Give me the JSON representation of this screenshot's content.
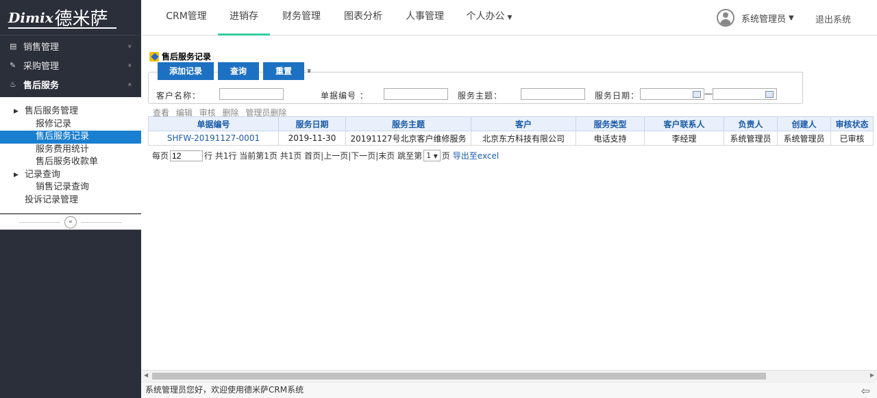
{
  "logo": {
    "latin": "Dimix",
    "chinese": "德米萨"
  },
  "sidebar": {
    "groups": [
      {
        "label": "销售管理",
        "icon": "table-icon",
        "chevron": "»"
      },
      {
        "label": "采购管理",
        "icon": "edit-icon",
        "chevron": "»"
      },
      {
        "label": "售后服务",
        "icon": "fire-icon",
        "chevron": "«"
      }
    ],
    "submenu": [
      {
        "label": "售后服务管理",
        "level": 1,
        "expandable": true
      },
      {
        "label": "报修记录",
        "level": 2
      },
      {
        "label": "售后服务记录",
        "level": 2,
        "selected": true
      },
      {
        "label": "服务费用统计",
        "level": 2
      },
      {
        "label": "售后服务收款单",
        "level": 2
      },
      {
        "label": "记录查询",
        "level": 1,
        "expandable": true
      },
      {
        "label": "销售记录查询",
        "level": 2
      },
      {
        "label": "投诉记录管理",
        "level": 1
      }
    ],
    "collapse_symbol": "«"
  },
  "topnav": {
    "tabs": [
      "CRM管理",
      "进销存",
      "财务管理",
      "图表分析",
      "人事管理",
      "个人办公"
    ],
    "active_tab": "进销存",
    "user_name": "系统管理员",
    "logout": "退出系统"
  },
  "page": {
    "title": "售后服务记录",
    "buttons": {
      "add": "添加记录",
      "query": "查询",
      "reset": "重置",
      "toggle": "»"
    },
    "filters": {
      "customer_label": "客户名称：",
      "doc_no_label": "单据编号 ：",
      "subject_label": "服务主题：",
      "date_label": "服务日期：",
      "date_separator": "—"
    },
    "actions": [
      "查看",
      "编辑",
      "审核",
      "删除",
      "管理员删除"
    ],
    "table": {
      "headers": [
        "单据编号",
        "服务日期",
        "服务主题",
        "客户",
        "服务类型",
        "客户联系人",
        "负责人",
        "创建人",
        "审核状态"
      ],
      "rows": [
        [
          "SHFW-20191127-0001",
          "2019-11-30",
          "20191127号北京客户维修服务",
          "北京东方科技有限公司",
          "电话支持",
          "李经理",
          "系统管理员",
          "系统管理员",
          "已审核"
        ]
      ]
    },
    "pager": {
      "per_page_prefix": "每页",
      "per_page_value": "12",
      "summary": "行 共1行  当前第1页  共1页  首页|上一页|下一页|末页  跳至第",
      "page_select": "1",
      "page_suffix": "页",
      "export": "导出至excel"
    }
  },
  "statusbar": {
    "message": "系统管理员您好，欢迎使用德米萨CRM系统"
  },
  "colors": {
    "sidebar_bg": "#2b2f3a",
    "primary_blue": "#1d71c2",
    "selected_blue": "#1a7fd0",
    "active_tab_underline": "#33cc99"
  }
}
